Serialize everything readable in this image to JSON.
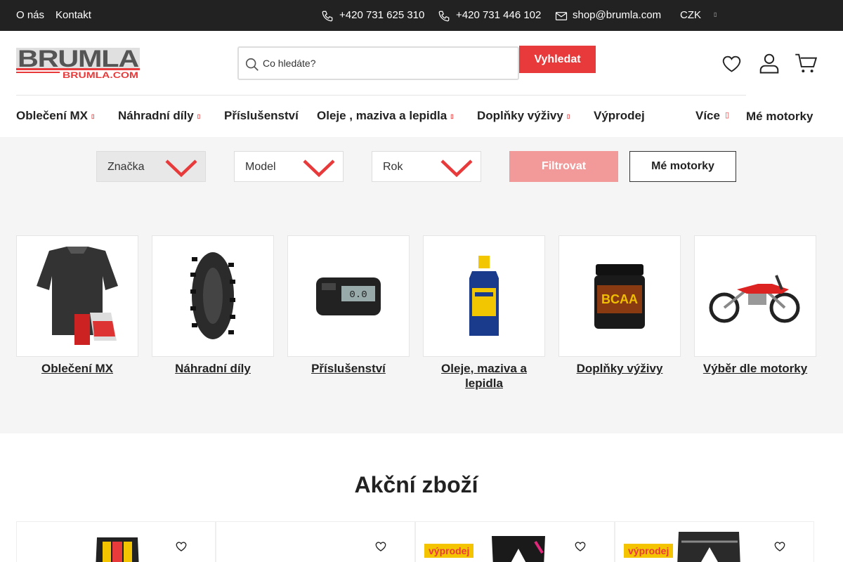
{
  "topbar": {
    "about": "O nás",
    "contact": "Kontakt",
    "phone1": "+420 731 625 310",
    "phone2": "+420 731 446 102",
    "email": "shop@brumla.com",
    "currency": "CZK"
  },
  "header": {
    "logo_text": "BRUMLA",
    "logo_sub": "BRUMLA.COM",
    "search_placeholder": "Co hledáte?",
    "search_button": "Vyhledat"
  },
  "nav": {
    "items": [
      {
        "label": "Oblečení MX"
      },
      {
        "label": "Náhradní díly"
      },
      {
        "label": "Příslušenství"
      },
      {
        "label": "Oleje , maziva a lepidla"
      },
      {
        "label": "Doplňky výživy"
      },
      {
        "label": "Výprodej"
      },
      {
        "label": "Více"
      }
    ],
    "my_bikes": "Mé motorky"
  },
  "filter": {
    "brand": "Značka",
    "model": "Model",
    "year": "Rok",
    "filter_button": "Filtrovat",
    "my_bikes_button": "Mé motorky"
  },
  "categories": [
    {
      "name": "Oblečení MX"
    },
    {
      "name": "Náhradní díly"
    },
    {
      "name": "Příslušenství"
    },
    {
      "name": "Oleje, maziva a lepidla"
    },
    {
      "name": "Doplňky výživy"
    },
    {
      "name": "Výběr dle motorky"
    }
  ],
  "sale": {
    "title": "Akční zboží",
    "badge": "výprodej"
  },
  "colors": {
    "accent": "#e83a3a",
    "topbar": "#222222",
    "badge_bg": "#f5c400"
  }
}
